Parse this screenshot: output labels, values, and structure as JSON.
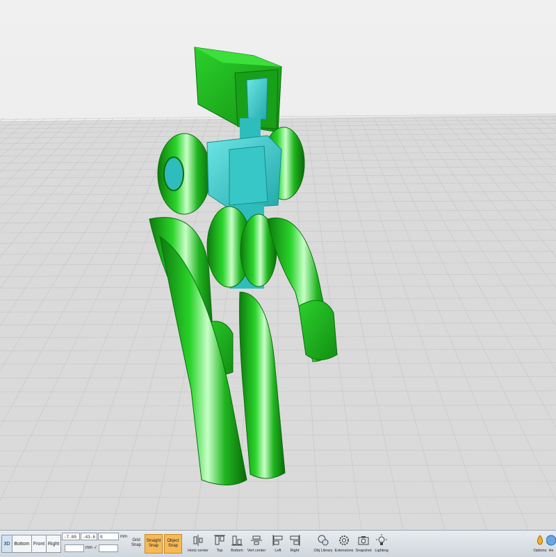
{
  "viewport": {
    "model_colors": {
      "primary": "#1fb51f",
      "secondary": "#3ccfd0",
      "grid_background": "#d9d9d9",
      "sky": "#ececec"
    }
  },
  "toolbar": {
    "view_buttons": [
      "3D",
      "Bottom",
      "Front",
      "Right"
    ],
    "coords": {
      "x": "-7.00",
      "y": "-43.6",
      "z": "0",
      "unit1": "mm",
      "unit2": "mm",
      "angle_sep": "-/"
    },
    "snap": {
      "grid_line1": "Grid",
      "grid_line2": "Snap",
      "straight_line1": "Straight",
      "straight_line2": "Snap",
      "object_line1": "Object",
      "object_line2": "Snap"
    },
    "align": {
      "horiz_center": "Horiz center",
      "top": "Top",
      "bottom": "Bottom",
      "vert_center": "Vert center",
      "left": "Left",
      "right": "Right"
    },
    "tools": {
      "obj_library": "Obj Library",
      "extensions": "Extensions",
      "snapshot": "Snapshot",
      "lighting": "Lighting",
      "options": "Options",
      "help": "He"
    }
  }
}
